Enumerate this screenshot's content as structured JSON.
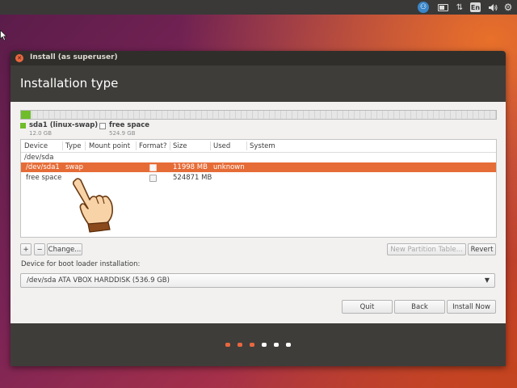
{
  "topbar": {
    "accessibility_icon": "accessibility-icon",
    "battery_icon": "battery-icon",
    "network_icon": "network-arrows-icon",
    "language": "En",
    "sound_icon": "speaker-icon",
    "settings_icon": "gear-icon"
  },
  "window": {
    "title": "Install (as superuser)",
    "heading": "Installation type"
  },
  "partition_bar": {
    "used_fraction": 0.022,
    "colors": {
      "used": "#6fbd2b",
      "free": "#e6e6e6"
    },
    "legend": [
      {
        "name": "sda1 (linux-swap)",
        "size": "12.0 GB",
        "color": "#6fbd2b"
      },
      {
        "name": "free space",
        "size": "524.9 GB",
        "color": "#ffffff"
      }
    ]
  },
  "table": {
    "columns": [
      "Device",
      "Type",
      "Mount point",
      "Format?",
      "Size",
      "Used",
      "System"
    ],
    "group": "/dev/sda",
    "rows": [
      {
        "device": "/dev/sda1",
        "type": "swap",
        "mount": "",
        "format": false,
        "size": "11998 MB",
        "used": "unknown",
        "system": "",
        "selected": true
      },
      {
        "device": "free space",
        "type": "",
        "mount": "",
        "format": false,
        "size": "524871 MB",
        "used": "",
        "system": "",
        "selected": false
      }
    ]
  },
  "buttons": {
    "add": "+",
    "remove": "−",
    "change": "Change...",
    "new_table": "New Partition Table...",
    "revert": "Revert",
    "quit": "Quit",
    "back": "Back",
    "install_now": "Install Now"
  },
  "bootloader": {
    "label": "Device for boot loader installation:",
    "value": "/dev/sda ATA VBOX HARDDISK (536.9 GB)"
  },
  "progress_dots": {
    "total": 6,
    "completed": 3,
    "colors": {
      "done": "#e9673f",
      "todo": "#ffffff"
    }
  },
  "accent_color": "#e66c37"
}
